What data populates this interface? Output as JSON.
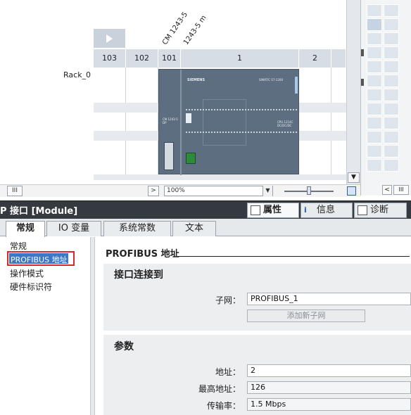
{
  "device_view": {
    "rack_name": "Rack_0",
    "slots": [
      "103",
      "102",
      "101",
      "1",
      "2"
    ],
    "module_labels": [
      "CM 1243-5",
      "1243-5 m"
    ],
    "cpu_brand": "SIEMENS",
    "cpu_model": "SIMATIC S7-1200",
    "cpu_text": "CPU 1214C DC/DC/DC",
    "cm_text": "CM 1243-5 DP"
  },
  "toolbar": {
    "zoom": "100%",
    "scroll_left": "III",
    "scroll_right": ">"
  },
  "inspector": {
    "title": "P 接口 [Module]",
    "tabs": [
      {
        "label": "属性",
        "icon": "properties-icon",
        "active": true
      },
      {
        "label": "信息",
        "icon": "info-icon",
        "active": false
      },
      {
        "label": "诊断",
        "icon": "diagnostics-icon",
        "active": false
      }
    ]
  },
  "subtabs": [
    {
      "label": "常规",
      "active": true
    },
    {
      "label": "IO 变量",
      "active": false
    },
    {
      "label": "系统常数",
      "active": false
    },
    {
      "label": "文本",
      "active": false
    }
  ],
  "nav": {
    "items": [
      "常规",
      "PROFIBUS 地址",
      "操作模式",
      "硬件标识符"
    ],
    "selected": "PROFIBUS 地址"
  },
  "content": {
    "heading": "PROFIBUS 地址",
    "section1": {
      "title": "接口连接到",
      "subnet_label": "子网：",
      "subnet_value": "PROFIBUS_1",
      "add_subnet_button": "添加新子网"
    },
    "section2": {
      "title": "参数",
      "address_label": "地址：",
      "address_value": "2",
      "highest_label": "最高地址：",
      "highest_value": "126",
      "rate_label": "传输率：",
      "rate_value": "1.5 Mbps"
    }
  },
  "colors": {
    "selection_blue": "#3d78c8",
    "highlight_red": "#d9282f",
    "title_bar": "#353a40"
  }
}
